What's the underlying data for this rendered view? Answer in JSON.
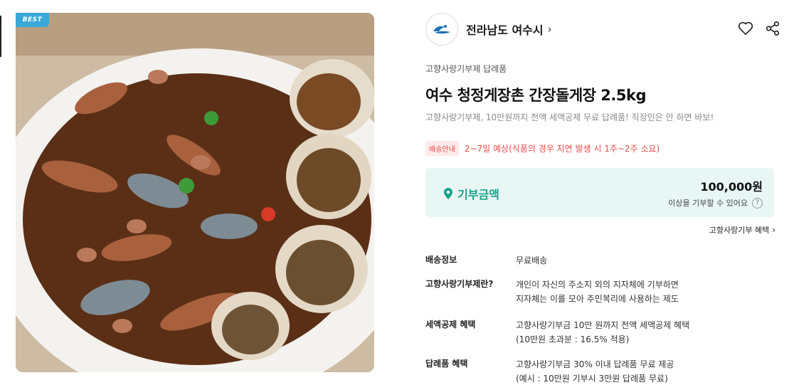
{
  "badge": {
    "best": "BEST"
  },
  "seller": {
    "name": "전라남도 여수시",
    "chevron": "›"
  },
  "icons": {
    "like": "heart-icon",
    "share": "share-icon"
  },
  "product": {
    "category": "고향사랑기부제 답례품",
    "title": "여수 청정게장촌 간장돌게장 2.5kg",
    "subtitle": "고향사랑기부제, 10만원까지 전액 세액공제 무료 답례품! 직장인은 안 하면 바보!"
  },
  "shipping": {
    "badge": "배송안내",
    "text": "2~7일 예상(식품의 경우 지연 발생 시 1주~2주 소요)"
  },
  "donation": {
    "label": "기부금액",
    "amount": "100,000원",
    "note": "이상을 기부할 수 있어요",
    "help": "?"
  },
  "benefit_link": "고향사랑기부 혜택",
  "info": [
    {
      "label": "배송정보",
      "lines": [
        "무료배송"
      ]
    },
    {
      "label": "고향사랑기부제란?",
      "lines": [
        "개인이 자신의 주소지 외의 지자체에 기부하면",
        "지자체는 이를 모아 주민복리에 사용하는 제도"
      ]
    },
    {
      "label": "세액공제 혜택",
      "lines": [
        "고향사랑기부금 10만 원까지 전액 세액공제 혜택",
        "(10만원 초과분 : 16.5% 적용)"
      ]
    },
    {
      "label": "답례품 혜택",
      "lines": [
        "고향사랑기부금 30% 이내 답례품 무료 제공",
        "(예시 : 10만원 기부시 3만원 답례품 무료)"
      ]
    }
  ],
  "colors": {
    "accent": "#17a58c",
    "shipping": "#e94b4b",
    "badge": "#3aa8d8",
    "panel": "#e8f6f4"
  }
}
